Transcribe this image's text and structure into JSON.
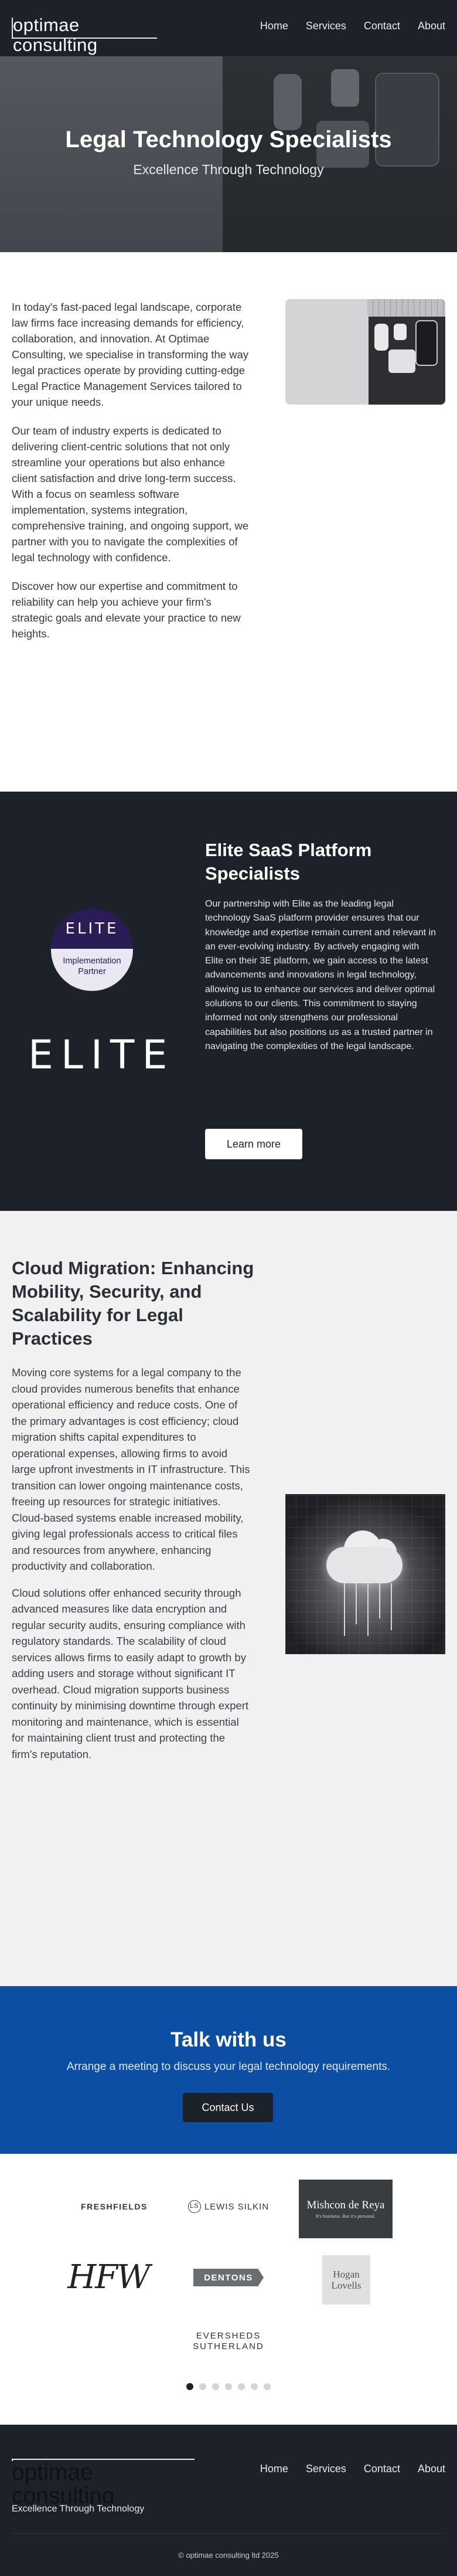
{
  "header": {
    "logo": "optimae consulting",
    "nav": [
      "Home",
      "Services",
      "Contact",
      "About"
    ]
  },
  "hero": {
    "title": "Legal Technology Specialists",
    "subtitle": "Excellence Through Technology"
  },
  "intro": {
    "paragraphs": [
      "In today's fast-paced legal landscape, corporate law firms face increasing demands for efficiency, collaboration, and innovation. At Optimae Consulting, we specialise in transforming the way legal practices operate by providing cutting-edge Legal Practice Management Services tailored to your unique needs.",
      "Our team of industry experts is dedicated to delivering client-centric solutions that not only streamline your operations but also enhance client satisfaction and drive long-term success. With a focus on seamless software implementation, systems integration, comprehensive training, and ongoing support, we partner with you to navigate the complexities of legal technology with confidence.",
      "Discover how our expertise and commitment to reliability can help you achieve your firm's strategic goals and elevate your practice to new heights."
    ]
  },
  "elite": {
    "badge_top": "ELITE",
    "badge_bottom": "Implementation Partner",
    "logo": "ELITE",
    "title": "Elite SaaS Platform Specialists",
    "text": "Our partnership with Elite as the leading legal technology SaaS platform provider ensures that our knowledge and expertise remain current and relevant in an ever-evolving industry. By actively engaging with Elite on their 3E platform, we gain access to the latest advancements and innovations in legal technology, allowing us to enhance our services and deliver optimal solutions to our clients. This commitment to staying informed not only strengthens our professional capabilities but also positions us as a trusted partner in navigating the complexities of the legal landscape.",
    "button": "Learn more"
  },
  "cloud": {
    "title": "Cloud Migration: Enhancing Mobility, Security, and Scalability for Legal Practices",
    "paragraphs": [
      "Moving core systems for a legal company to the cloud provides numerous benefits that enhance operational efficiency and reduce costs. One of the primary advantages is cost efficiency; cloud migration shifts capital expenditures to operational expenses, allowing firms to avoid large upfront investments in IT infrastructure. This transition can lower ongoing maintenance costs, freeing up resources for strategic initiatives. Cloud-based systems enable increased mobility, giving legal professionals access to critical files and resources from anywhere, enhancing productivity and collaboration.",
      "Cloud solutions offer enhanced security through advanced measures like data encryption and regular security audits, ensuring compliance with regulatory standards. The scalability of cloud services allows firms to easily adapt to growth by adding users and storage without significant IT overhead. Cloud migration supports business continuity by minimising downtime through expert monitoring and maintenance, which is essential for maintaining client trust and protecting the firm's reputation."
    ]
  },
  "talk": {
    "title": "Talk with us",
    "subtitle": "Arrange a meeting to discuss your legal technology requirements.",
    "button": "Contact Us"
  },
  "clients": {
    "freshfields": "FRESHFIELDS",
    "lewis_silkin": "LEWIS SILKIN",
    "lewis_silkin_mark": "LS",
    "mishcon": "Mishcon de Reya",
    "mishcon_tag": "It's business. But it's personal.",
    "hfw": "HFW",
    "dentons": "DENTONS",
    "hogan_1": "Hogan",
    "hogan_2": "Lovells",
    "eversheds_1": "EVERSHEDS",
    "eversheds_2": "SUTHERLAND",
    "carousel_pages": 7,
    "carousel_active": 1
  },
  "footer": {
    "logo": "optimae consulting",
    "tagline": "Excellence Through Technology",
    "nav": [
      "Home",
      "Services",
      "Contact",
      "About"
    ],
    "copyright": "© optimae consulting ltd 2025"
  }
}
